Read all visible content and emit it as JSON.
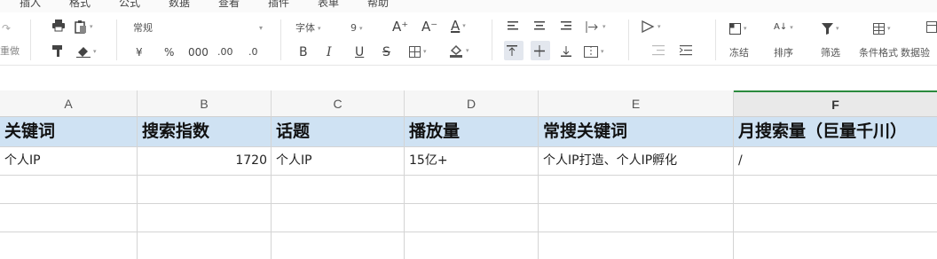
{
  "menu": [
    "插入",
    "格式",
    "公式",
    "数据",
    "查看",
    "插件",
    "表单",
    "帮助"
  ],
  "ribbon": {
    "redo_label": "重做",
    "number_format": "常规",
    "currency_symbol": "¥",
    "percent_symbol": "%",
    "thousands_symbol": "000",
    "font_name": "字体",
    "font_size": "9",
    "bold": "B",
    "italic": "I",
    "underline": "U",
    "strike": "S",
    "font_grow": "A⁺",
    "font_shrink": "A⁻",
    "font_color": "A",
    "freeze_label": "冻结",
    "sort_label": "排序",
    "filter_label": "筛选",
    "cond_format_label": "条件格式",
    "data_validation_label": "数据验"
  },
  "columns": [
    "A",
    "B",
    "C",
    "D",
    "E",
    "F"
  ],
  "active_column": "F",
  "sheet": {
    "header_row": [
      "关键词",
      "搜索指数",
      "话题",
      "播放量",
      "常搜关键词",
      "月搜索量（巨量千川）"
    ],
    "rows": [
      [
        "个人IP",
        "1720",
        "个人IP",
        "15亿+",
        "个人IP打造、个人IP孵化",
        "/"
      ]
    ]
  },
  "colors": {
    "header_fill": "#cfe2f3",
    "active_column_accent": "#2b8a3e",
    "selected_tool_bg": "#e3e7ee"
  }
}
